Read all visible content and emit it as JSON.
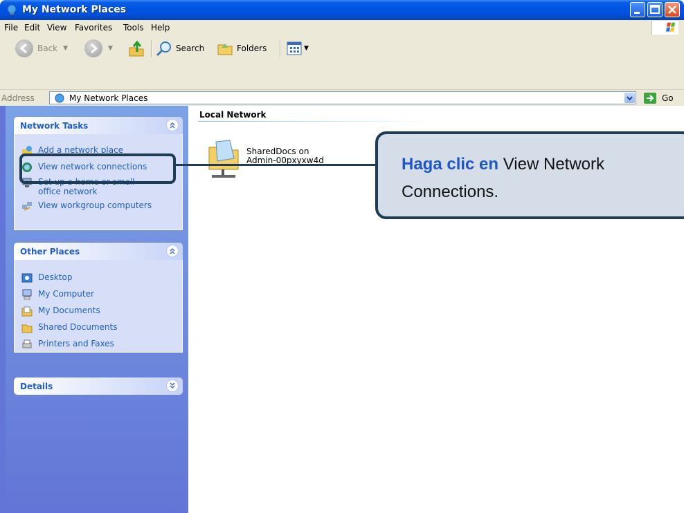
{
  "window": {
    "title": "My Network Places"
  },
  "menu": [
    "File",
    "Edit",
    "View",
    "Favorites",
    "Tools",
    "Help"
  ],
  "toolbar": {
    "back_label": "Back",
    "search_label": "Search",
    "folders_label": "Folders"
  },
  "address": {
    "label": "Address",
    "value": "My Network Places",
    "go_label": "Go"
  },
  "network_tasks": {
    "title": "Network Tasks",
    "items": [
      {
        "label": "Add a network place",
        "icon": "add-network-place-icon"
      },
      {
        "label": "View network connections",
        "icon": "network-connections-icon"
      },
      {
        "label": "Set up a home or small office network",
        "icon": "home-network-setup-icon"
      },
      {
        "label": "View workgroup computers",
        "icon": "workgroup-computers-icon"
      }
    ]
  },
  "other_places": {
    "title": "Other Places",
    "items": [
      {
        "label": "Desktop",
        "icon": "desktop-icon"
      },
      {
        "label": "My Computer",
        "icon": "my-computer-icon"
      },
      {
        "label": "My Documents",
        "icon": "my-documents-icon"
      },
      {
        "label": "Shared Documents",
        "icon": "shared-documents-icon"
      },
      {
        "label": "Printers and Faxes",
        "icon": "printers-faxes-icon"
      }
    ]
  },
  "details": {
    "title": "Details"
  },
  "content": {
    "group_title": "Local Network",
    "item_line1": "SharedDocs on",
    "item_line2": "Admin-00pxyxw4d"
  },
  "callout": {
    "highlight": "Haga clic en",
    "rest_line1": " View Network",
    "rest_line2": "Connections."
  },
  "colors": {
    "titlebar": "#0054e3",
    "link": "#215dc6",
    "callout_border": "#1f3c55",
    "callout_bg": "#d5dde8"
  }
}
